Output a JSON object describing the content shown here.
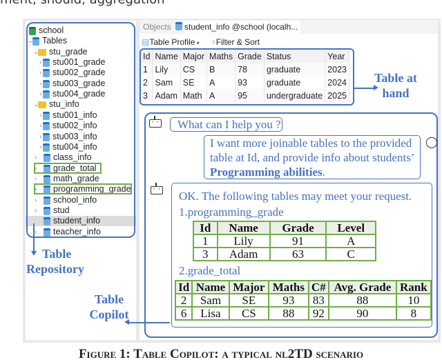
{
  "top_text": "ment, should, aggregation",
  "tree": {
    "items": [
      {
        "label": "school",
        "icon": "database-icon",
        "level": 0
      },
      {
        "label": "Tables",
        "icon": "tables-icon",
        "level": 1,
        "expanded": true
      },
      {
        "label": "stu_grade",
        "icon": "folder-icon",
        "level": 2,
        "expanded": true
      },
      {
        "label": "stu001_grade",
        "icon": "table-icon",
        "level": 3
      },
      {
        "label": "stu002_grade",
        "icon": "table-icon",
        "level": 3
      },
      {
        "label": "stu003_grade",
        "icon": "table-icon",
        "level": 3
      },
      {
        "label": "stu004_grade",
        "icon": "table-icon",
        "level": 3
      },
      {
        "label": "stu_info",
        "icon": "folder-icon",
        "level": 2,
        "expanded": true
      },
      {
        "label": "stu001_info",
        "icon": "table-icon",
        "level": 3
      },
      {
        "label": "stu002_info",
        "icon": "table-icon",
        "level": 3
      },
      {
        "label": "stu003_info",
        "icon": "table-icon",
        "level": 3
      },
      {
        "label": "stu004_info",
        "icon": "table-icon",
        "level": 3
      },
      {
        "label": "class_info",
        "icon": "table-icon",
        "level": 2
      },
      {
        "label": "grade_total",
        "icon": "table-icon",
        "level": 2,
        "highlighted": true
      },
      {
        "label": "math_grade",
        "icon": "table-icon",
        "level": 2
      },
      {
        "label": "programming_grade",
        "icon": "table-icon",
        "level": 2,
        "highlighted": true
      },
      {
        "label": "school_info",
        "icon": "table-icon",
        "level": 2
      },
      {
        "label": "stud",
        "icon": "table-icon",
        "level": 2
      },
      {
        "label": "student_info",
        "icon": "table-icon",
        "level": 2,
        "selected": true
      },
      {
        "label": "teacher_info",
        "icon": "table-icon",
        "level": 2
      }
    ]
  },
  "tabs": {
    "objects": "Objects",
    "active": "student_info @school (localh..."
  },
  "toolbar": {
    "table_profile": "Table Profile",
    "filter_sort": "Filter & Sort"
  },
  "table": {
    "headers": [
      "Id",
      "Name",
      "Major",
      "Maths",
      "Grade",
      "Status",
      "Year"
    ],
    "rows": [
      [
        "1",
        "Lily",
        "CS",
        "B",
        "78",
        "graduate",
        "2023"
      ],
      [
        "2",
        "Sam",
        "SE",
        "A",
        "93",
        "graduate",
        "2024"
      ],
      [
        "3",
        "Adam",
        "Math",
        "A",
        "95",
        "undergraduate",
        "2025"
      ]
    ]
  },
  "annotations": {
    "table_at_hand": [
      "Table at",
      "hand"
    ],
    "table_repository": [
      "Table",
      "Repository"
    ],
    "table_copilot": [
      "Table",
      "Copilot"
    ]
  },
  "chat": {
    "greeting": "What can I help you ?",
    "user_msg_plain": "I want more joinable tables to the provided table at Id, and provide info about students’ ",
    "user_msg_bold": "Programming abilities",
    "user_msg_end": ".",
    "reply_intro": "OK. The following tables may meet your request.",
    "result1_title": "1.programming_grade",
    "result1": {
      "headers": [
        "Id",
        "Name",
        "Grade",
        "Level"
      ],
      "rows": [
        [
          "1",
          "Lily",
          "91",
          "A"
        ],
        [
          "3",
          "Adam",
          "63",
          "C"
        ]
      ]
    },
    "result2_title": "2.grade_total",
    "result2": {
      "headers": [
        "Id",
        "Name",
        "Major",
        "Maths",
        "C#",
        "Avg. Grade",
        "Rank"
      ],
      "rows": [
        [
          "2",
          "Sam",
          "SE",
          "93",
          "83",
          "88",
          "10"
        ],
        [
          "6",
          "Lisa",
          "CS",
          "88",
          "92",
          "90",
          "8"
        ]
      ]
    }
  },
  "caption": "Figure 1: Table Copilot: a typical nl2TD scenario",
  "colors": {
    "annotation_blue": "#4472c4",
    "highlight_green": "#70ad47"
  }
}
